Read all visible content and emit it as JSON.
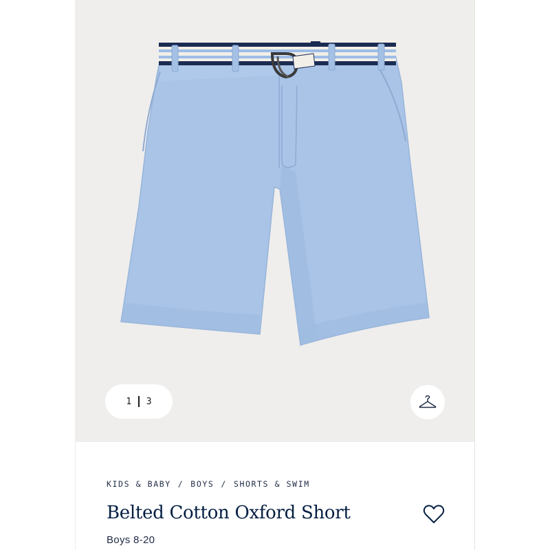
{
  "gallery": {
    "current_index": "1",
    "total_count": "3",
    "product_image_alt": "Light blue belted oxford shorts"
  },
  "breadcrumb": {
    "items": [
      "KIDS & BABY",
      "BOYS",
      "SHORTS & SWIM"
    ],
    "separator": "/"
  },
  "product": {
    "title": "Belted Cotton Oxford Short",
    "subtitle": "Boys 8-20"
  },
  "colors": {
    "background_gallery": "#efeeec",
    "shorts": "#a8c3e6",
    "navy": "#041e42"
  },
  "icons": {
    "hanger": "hanger-icon",
    "favorite": "heart-outline-icon"
  }
}
